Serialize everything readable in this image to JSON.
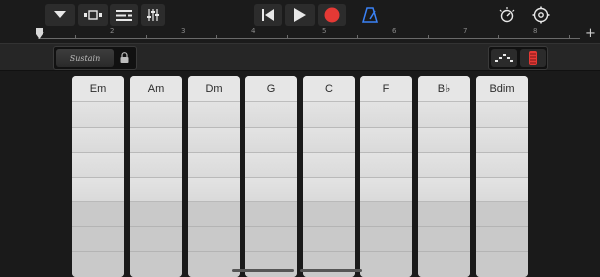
{
  "toolbar": {
    "left_icons": [
      "dropdown-triangle-icon",
      "tracks-view-icon",
      "list-view-icon",
      "mixer-icon"
    ],
    "transport_icons": [
      "rewind-icon",
      "play-icon",
      "record-icon"
    ],
    "metronome_icon": "metronome-icon",
    "right_icons": [
      "master-volume-icon",
      "settings-gear-icon"
    ],
    "accent_color": "#3b82f6",
    "record_color": "#e53935"
  },
  "ruler": {
    "numbers": [
      "1",
      "2",
      "3",
      "4",
      "5",
      "6",
      "7",
      "8"
    ],
    "add_section_label": "+"
  },
  "controls": {
    "sustain_label": "Sustain",
    "lock_icon": "lock-icon",
    "mode_icons": [
      "arpeggiator-icon",
      "autoplay-knob-icon"
    ]
  },
  "chords": [
    {
      "label": "Em"
    },
    {
      "label": "Am"
    },
    {
      "label": "Dm"
    },
    {
      "label": "G"
    },
    {
      "label": "C"
    },
    {
      "label": "F"
    },
    {
      "label": "B♭"
    },
    {
      "label": "Bdim"
    }
  ]
}
